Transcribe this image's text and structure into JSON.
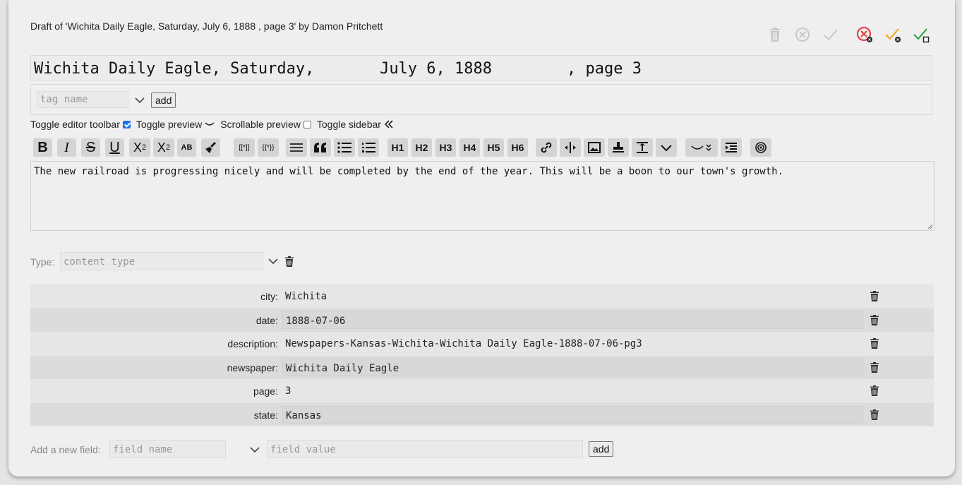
{
  "header": {
    "draft_label": "Draft of 'Wichita Daily Eagle, Saturday,  July 6, 1888 , page 3' by Damon Pritchett"
  },
  "actions": [
    {
      "name": "delete-draft",
      "icon": "trash-icon",
      "color": "#c8c8c8"
    },
    {
      "name": "cancel",
      "icon": "circle-x-icon",
      "color": "#c8c8c8"
    },
    {
      "name": "accept",
      "icon": "check-icon",
      "color": "#c8c8c8"
    },
    {
      "name": "reject",
      "icon": "circle-x-badge-icon",
      "color": "#e53935"
    },
    {
      "name": "approve-partial",
      "icon": "check-badge-icon",
      "color": "#f0a818"
    },
    {
      "name": "approve",
      "icon": "check-square-icon",
      "color": "#2e9e3e"
    }
  ],
  "title": {
    "value": "Wichita Daily Eagle, Saturday,       July 6, 1888        , page 3"
  },
  "tags": {
    "placeholder": "tag name",
    "add_label": "add"
  },
  "toggles": {
    "editor_toolbar": "Toggle editor toolbar",
    "editor_toolbar_checked": true,
    "preview": "Toggle preview",
    "scrollable_preview": "Scrollable preview",
    "scrollable_preview_checked": false,
    "sidebar": "Toggle sidebar"
  },
  "toolbar": {
    "bold": "B",
    "italic": "I",
    "strike": "S",
    "underline": "U",
    "superscript": "X",
    "superscript_sup": "2",
    "subscript": "X",
    "subscript_sub": "2",
    "smallcaps": "AB",
    "link_template": "[[*]]",
    "template": "{{*}}",
    "h1": "H1",
    "h2": "H2",
    "h3": "H3",
    "h4": "H4",
    "h5": "H5",
    "h6": "H6"
  },
  "editor": {
    "text": "The new railroad is progressing nicely and will be completed by the end of the year. This will be a boon to our town's growth."
  },
  "type": {
    "label": "Type:",
    "placeholder": "content type"
  },
  "fields": [
    {
      "key": "city:",
      "value": "Wichita"
    },
    {
      "key": "date:",
      "value": "1888-07-06"
    },
    {
      "key": "description:",
      "value": "Newspapers-Kansas-Wichita-Wichita Daily Eagle-1888-07-06-pg3"
    },
    {
      "key": "newspaper:",
      "value": "Wichita Daily Eagle"
    },
    {
      "key": "page:",
      "value": "3"
    },
    {
      "key": "state:",
      "value": "Kansas"
    }
  ],
  "new_field": {
    "label": "Add a new field:",
    "name_placeholder": "field name",
    "value_placeholder": "field value",
    "add_label": "add"
  }
}
